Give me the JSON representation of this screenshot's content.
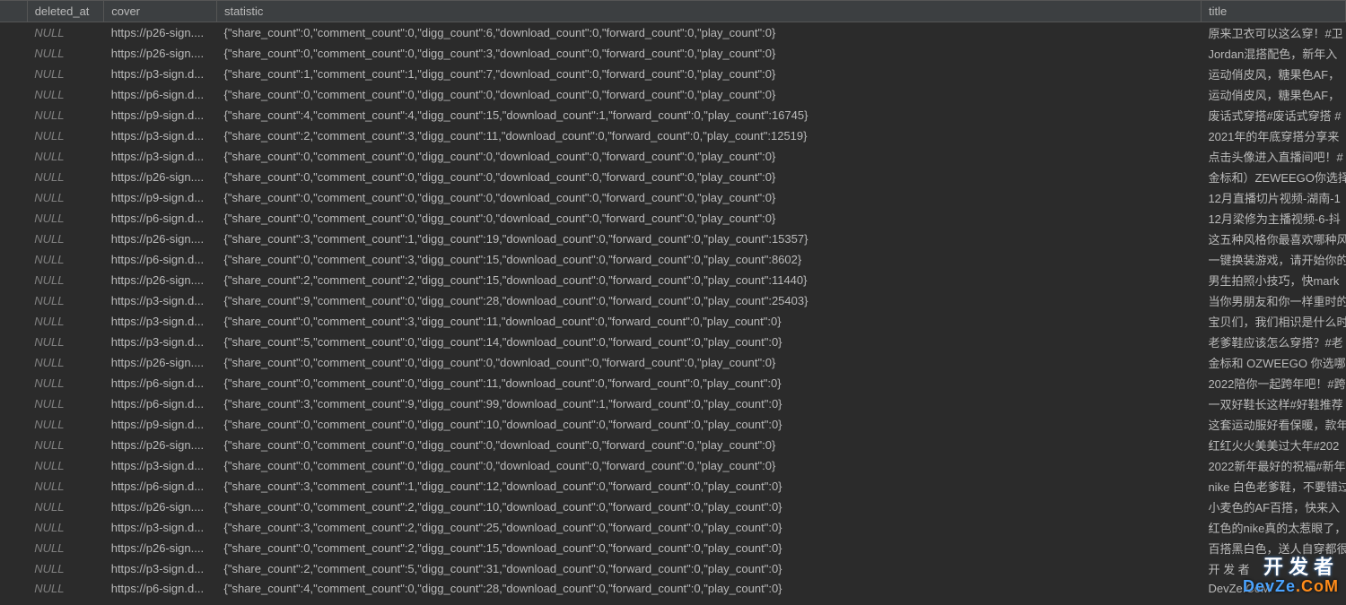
{
  "columns": {
    "deleted_at": "deleted_at",
    "cover": "cover",
    "statistic": "statistic",
    "title": "title"
  },
  "null_label": "NULL",
  "rows": [
    {
      "deleted_at": null,
      "cover": "https://p26-sign....",
      "statistic": "{\"share_count\":0,\"comment_count\":0,\"digg_count\":6,\"download_count\":0,\"forward_count\":0,\"play_count\":0}",
      "title": "原来卫衣可以这么穿！#卫"
    },
    {
      "deleted_at": null,
      "cover": "https://p26-sign....",
      "statistic": "{\"share_count\":0,\"comment_count\":0,\"digg_count\":3,\"download_count\":0,\"forward_count\":0,\"play_count\":0}",
      "title": "Jordan混搭配色，新年入"
    },
    {
      "deleted_at": null,
      "cover": "https://p3-sign.d...",
      "statistic": "{\"share_count\":1,\"comment_count\":1,\"digg_count\":7,\"download_count\":0,\"forward_count\":0,\"play_count\":0}",
      "title": "运动俏皮风，糖果色AF，"
    },
    {
      "deleted_at": null,
      "cover": "https://p6-sign.d...",
      "statistic": "{\"share_count\":0,\"comment_count\":0,\"digg_count\":0,\"download_count\":0,\"forward_count\":0,\"play_count\":0}",
      "title": "运动俏皮风，糖果色AF，"
    },
    {
      "deleted_at": null,
      "cover": "https://p9-sign.d...",
      "statistic": "{\"share_count\":4,\"comment_count\":4,\"digg_count\":15,\"download_count\":1,\"forward_count\":0,\"play_count\":16745}",
      "title": "废话式穿搭#废话式穿搭 #"
    },
    {
      "deleted_at": null,
      "cover": "https://p3-sign.d...",
      "statistic": "{\"share_count\":2,\"comment_count\":3,\"digg_count\":11,\"download_count\":0,\"forward_count\":0,\"play_count\":12519}",
      "title": "2021年的年底穿搭分享来"
    },
    {
      "deleted_at": null,
      "cover": "https://p3-sign.d...",
      "statistic": "{\"share_count\":0,\"comment_count\":0,\"digg_count\":0,\"download_count\":0,\"forward_count\":0,\"play_count\":0}",
      "title": "点击头像进入直播间吧！#"
    },
    {
      "deleted_at": null,
      "cover": "https://p26-sign....",
      "statistic": "{\"share_count\":0,\"comment_count\":0,\"digg_count\":0,\"download_count\":0,\"forward_count\":0,\"play_count\":0}",
      "title": "金标和）ZEWEEGO你选择"
    },
    {
      "deleted_at": null,
      "cover": "https://p9-sign.d...",
      "statistic": "{\"share_count\":0,\"comment_count\":0,\"digg_count\":0,\"download_count\":0,\"forward_count\":0,\"play_count\":0}",
      "title": "12月直播切片视频-湖南-1"
    },
    {
      "deleted_at": null,
      "cover": "https://p6-sign.d...",
      "statistic": "{\"share_count\":0,\"comment_count\":0,\"digg_count\":0,\"download_count\":0,\"forward_count\":0,\"play_count\":0}",
      "title": "12月梁修为主播视频-6-抖"
    },
    {
      "deleted_at": null,
      "cover": "https://p26-sign....",
      "statistic": "{\"share_count\":3,\"comment_count\":1,\"digg_count\":19,\"download_count\":0,\"forward_count\":0,\"play_count\":15357}",
      "title": "这五种风格你最喜欢哪种风"
    },
    {
      "deleted_at": null,
      "cover": "https://p6-sign.d...",
      "statistic": "{\"share_count\":0,\"comment_count\":3,\"digg_count\":15,\"download_count\":0,\"forward_count\":0,\"play_count\":8602}",
      "title": "一键换装游戏，请开始你的"
    },
    {
      "deleted_at": null,
      "cover": "https://p26-sign....",
      "statistic": "{\"share_count\":2,\"comment_count\":2,\"digg_count\":15,\"download_count\":0,\"forward_count\":0,\"play_count\":11440}",
      "title": "男生拍照小技巧，快mark"
    },
    {
      "deleted_at": null,
      "cover": "https://p3-sign.d...",
      "statistic": "{\"share_count\":9,\"comment_count\":0,\"digg_count\":28,\"download_count\":0,\"forward_count\":0,\"play_count\":25403}",
      "title": "当你男朋友和你一样重时的"
    },
    {
      "deleted_at": null,
      "cover": "https://p3-sign.d...",
      "statistic": "{\"share_count\":0,\"comment_count\":3,\"digg_count\":11,\"download_count\":0,\"forward_count\":0,\"play_count\":0}",
      "title": "宝贝们，我们相识是什么时"
    },
    {
      "deleted_at": null,
      "cover": "https://p3-sign.d...",
      "statistic": "{\"share_count\":5,\"comment_count\":0,\"digg_count\":14,\"download_count\":0,\"forward_count\":0,\"play_count\":0}",
      "title": "老爹鞋应该怎么穿搭？#老"
    },
    {
      "deleted_at": null,
      "cover": "https://p26-sign....",
      "statistic": "{\"share_count\":0,\"comment_count\":0,\"digg_count\":0,\"download_count\":0,\"forward_count\":0,\"play_count\":0}",
      "title": "金标和 OZWEEGO 你选哪"
    },
    {
      "deleted_at": null,
      "cover": "https://p6-sign.d...",
      "statistic": "{\"share_count\":0,\"comment_count\":0,\"digg_count\":11,\"download_count\":0,\"forward_count\":0,\"play_count\":0}",
      "title": "2022陪你一起跨年吧！#跨"
    },
    {
      "deleted_at": null,
      "cover": "https://p6-sign.d...",
      "statistic": "{\"share_count\":3,\"comment_count\":9,\"digg_count\":99,\"download_count\":1,\"forward_count\":0,\"play_count\":0}",
      "title": "一双好鞋长这样#好鞋推荐"
    },
    {
      "deleted_at": null,
      "cover": "https://p9-sign.d...",
      "statistic": "{\"share_count\":0,\"comment_count\":0,\"digg_count\":10,\"download_count\":0,\"forward_count\":0,\"play_count\":0}",
      "title": "这套运动服好看保暖，款年"
    },
    {
      "deleted_at": null,
      "cover": "https://p26-sign....",
      "statistic": "{\"share_count\":0,\"comment_count\":0,\"digg_count\":0,\"download_count\":0,\"forward_count\":0,\"play_count\":0}",
      "title": "红红火火美美过大年#202"
    },
    {
      "deleted_at": null,
      "cover": "https://p3-sign.d...",
      "statistic": "{\"share_count\":0,\"comment_count\":0,\"digg_count\":0,\"download_count\":0,\"forward_count\":0,\"play_count\":0}",
      "title": "2022新年最好的祝福#新年"
    },
    {
      "deleted_at": null,
      "cover": "https://p6-sign.d...",
      "statistic": "{\"share_count\":3,\"comment_count\":1,\"digg_count\":12,\"download_count\":0,\"forward_count\":0,\"play_count\":0}",
      "title": "nike 白色老爹鞋，不要错过"
    },
    {
      "deleted_at": null,
      "cover": "https://p26-sign....",
      "statistic": "{\"share_count\":0,\"comment_count\":2,\"digg_count\":10,\"download_count\":0,\"forward_count\":0,\"play_count\":0}",
      "title": "小麦色的AF百搭，快来入"
    },
    {
      "deleted_at": null,
      "cover": "https://p3-sign.d...",
      "statistic": "{\"share_count\":3,\"comment_count\":2,\"digg_count\":25,\"download_count\":0,\"forward_count\":0,\"play_count\":0}",
      "title": "红色的nike真的太惹眼了，"
    },
    {
      "deleted_at": null,
      "cover": "https://p26-sign....",
      "statistic": "{\"share_count\":0,\"comment_count\":2,\"digg_count\":15,\"download_count\":0,\"forward_count\":0,\"play_count\":0}",
      "title": "百搭黑白色，送人自穿都很"
    },
    {
      "deleted_at": null,
      "cover": "https://p3-sign.d...",
      "statistic": "{\"share_count\":2,\"comment_count\":5,\"digg_count\":31,\"download_count\":0,\"forward_count\":0,\"play_count\":0}",
      "title": "开 发 者"
    },
    {
      "deleted_at": null,
      "cover": "https://p6-sign.d...",
      "statistic": "{\"share_count\":4,\"comment_count\":0,\"digg_count\":28,\"download_count\":0,\"forward_count\":0,\"play_count\":0}",
      "title": "DevZe.CoM"
    }
  ],
  "watermark": {
    "line1": "开发者",
    "line2_dev": "Dev",
    "line2_ze": "Ze",
    "line2_dot": ".",
    "line2_com": "CoM"
  }
}
